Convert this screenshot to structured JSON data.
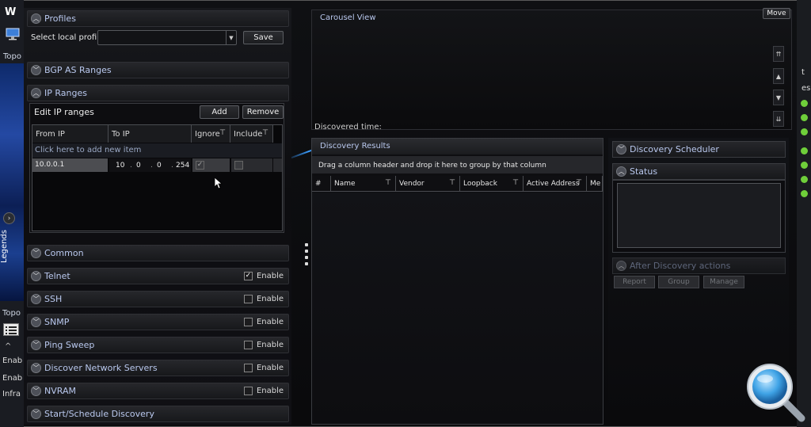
{
  "left_strip": {
    "logo": "W",
    "tab1": "Topo",
    "legends_label": "Legends",
    "tab2": "Topo",
    "row1": "Enab",
    "row2": "Enab",
    "row3": "Infra"
  },
  "right_strip": {
    "t1": "t",
    "t2": "es"
  },
  "profiles": {
    "title": "Profiles",
    "select_label": "Select local profile:",
    "selected_value": "",
    "save_label": "Save"
  },
  "bgp": {
    "title": "BGP AS Ranges"
  },
  "ip_ranges": {
    "title": "IP Ranges",
    "edit_label": "Edit IP ranges",
    "add_label": "Add",
    "remove_label": "Remove",
    "columns": [
      "From IP",
      "To IP",
      "Ignore",
      "Include"
    ],
    "add_new_item": "Click here to add new item",
    "row": {
      "from_ip": "10.0.0.1",
      "to_ip_octets": [
        "10",
        "0",
        "0",
        "254"
      ],
      "ignore": true,
      "include": false
    }
  },
  "sections": [
    {
      "title": "Common",
      "has_enable": false
    },
    {
      "title": "Telnet",
      "has_enable": true,
      "enabled": true
    },
    {
      "title": "SSH",
      "has_enable": true,
      "enabled": false
    },
    {
      "title": "SNMP",
      "has_enable": true,
      "enabled": false
    },
    {
      "title": "Ping Sweep",
      "has_enable": true,
      "enabled": false
    },
    {
      "title": "Discover Network Servers",
      "has_enable": true,
      "enabled": false
    },
    {
      "title": "NVRAM",
      "has_enable": true,
      "enabled": false
    },
    {
      "title": "Start/Schedule Discovery",
      "has_enable": false
    }
  ],
  "enable_label": "Enable",
  "carousel": {
    "title": "Carousel View",
    "move_label": "Move",
    "discovered_time_label": "Discovered time:"
  },
  "results": {
    "title": "Discovery Results",
    "group_hint": "Drag a column header and drop it here to group by that column",
    "columns": [
      "#",
      "Name",
      "Vendor",
      "Loopback",
      "Active Address",
      "Me"
    ]
  },
  "right_col": {
    "scheduler_title": "Discovery Scheduler",
    "status_title": "Status",
    "after_title": "After Discovery actions",
    "buttons": [
      "Report",
      "Group",
      "Manage"
    ]
  },
  "colors": {
    "accent_text": "#b9c8ee",
    "green_indicator": "#6fcf3a",
    "swoosh": "#3a9dff"
  }
}
